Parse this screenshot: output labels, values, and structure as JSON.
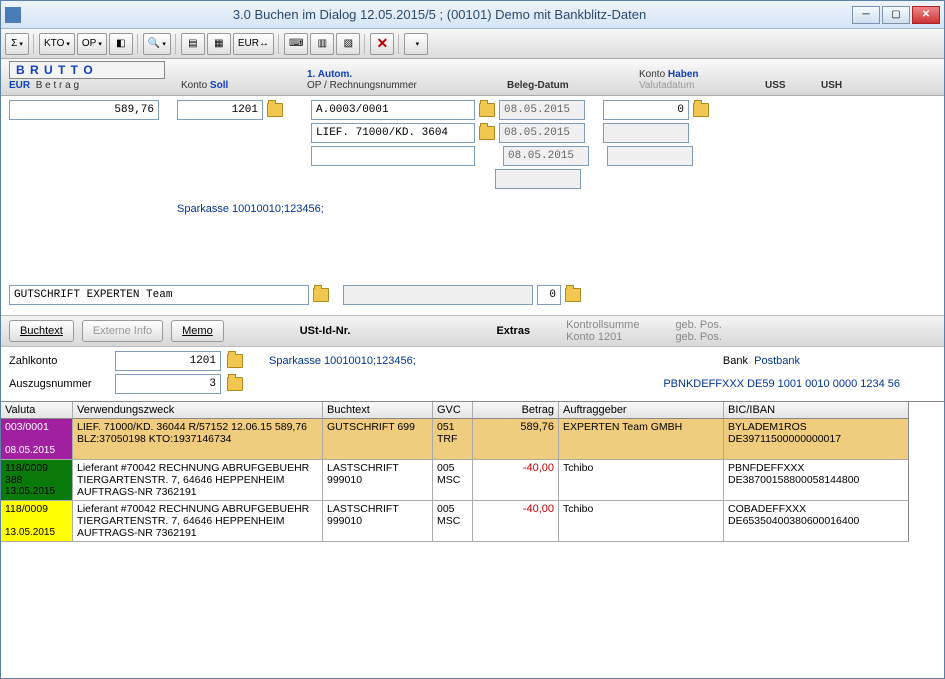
{
  "window": {
    "title": "3.0  Buchen im Dialog 12.05.2015/5 ; (00101) Demo mit Bankblitz-Daten"
  },
  "toolbar": {
    "sigma": "Σ",
    "kto": "KTO",
    "op": "OP",
    "eur": "EUR"
  },
  "header": {
    "brutto": "B R U T T O",
    "eur": "EUR",
    "betrag": "B e t r a g",
    "konto": "Konto",
    "soll": "Soll",
    "autom": "1. Autom.",
    "op_rechnung": "OP / Rechnungsnummer",
    "beleg_datum": "Beleg-Datum",
    "haben": "Haben",
    "valutadatum": "Valutadatum",
    "uss": "USS",
    "ush": "USH"
  },
  "form": {
    "betrag_value": "589,76",
    "soll_value": "1201",
    "op_values": [
      "A.0003/0001",
      "LIEF. 71000/KD. 3604",
      ""
    ],
    "beleg_values": [
      "08.05.2015",
      "08.05.2015",
      "08.05.2015",
      ""
    ],
    "haben_value": "0",
    "bank_info_soll": "Sparkasse 10010010;123456;",
    "buchtext_value": "GUTSCHRIFT EXPERTEN Team",
    "buchtext_num": "0"
  },
  "tabs": {
    "buchtext": "Buchtext",
    "externe": "Externe Info",
    "memo": "Memo",
    "ust_id": "USt-Id-Nr.",
    "extras": "Extras",
    "kontrollsumme": "Kontrollsumme",
    "konto1201": "Konto 1201",
    "geb_pos": "geb. Pos."
  },
  "zahl": {
    "zahlkonto_label": "Zahlkonto",
    "zahlkonto_value": "1201",
    "zahlkonto_info": "Sparkasse 10010010;123456;",
    "auszug_label": "Auszugsnummer",
    "auszug_value": "3",
    "bank_label": "Bank",
    "bank_name": "Postbank",
    "iban": "PBNKDEFFXXX  DE59 1001 0010 0000 1234 56"
  },
  "grid": {
    "headers": {
      "valuta": "Valuta",
      "vzweck": "Verwendungszweck",
      "btext": "Buchtext",
      "gvc": "GVC",
      "betrag": "Betrag",
      "auftrag": "Auftraggeber",
      "bic": "BIC/IBAN"
    },
    "rows": [
      {
        "valuta_l1": "003/0001",
        "valuta_l2": "",
        "valuta_l3": "08.05.2015",
        "valuta_class": "valuta-purple",
        "highlight": true,
        "vzweck": "LIEF. 71000/KD. 36044 R/57152    12.06.15 589,76 BLZ:37050198 KTO:1937146734",
        "btext": "GUTSCHRIFT 699",
        "gvc": "051 TRF",
        "betrag": "589,76",
        "betrag_neg": false,
        "auftrag": "EXPERTEN Team GMBH",
        "bic": "BYLADEM1ROS DE39711500000000017"
      },
      {
        "valuta_l1": "118/0009",
        "valuta_l2": "388",
        "valuta_l3": "13.05.2015",
        "valuta_class": "valuta-green",
        "highlight": false,
        "vzweck": "Lieferant #70042 RECHNUNG ABRUFGEBUEHR TIERGARTENSTR. 7, 64646 HEPPENHEIM AUFTRAGS-NR 7362191",
        "btext": "LASTSCHRIFT 999010",
        "gvc": "005 MSC",
        "betrag": "-40,00",
        "betrag_neg": true,
        "auftrag": "Tchibo",
        "bic": "PBNFDEFFXXX DE38700158800058144800"
      },
      {
        "valuta_l1": "118/0009",
        "valuta_l2": "",
        "valuta_l3": "13.05.2015",
        "valuta_class": "valuta-yellow",
        "highlight": false,
        "vzweck": "Lieferant #70042 RECHNUNG ABRUFGEBUEHR TIERGARTENSTR. 7, 64646 HEPPENHEIM AUFTRAGS-NR 7362191",
        "btext": "LASTSCHRIFT 999010",
        "gvc": "005 MSC",
        "betrag": "-40,00",
        "betrag_neg": true,
        "auftrag": "Tchibo",
        "bic": "COBADEFFXXX DE65350400380600016400"
      }
    ]
  }
}
